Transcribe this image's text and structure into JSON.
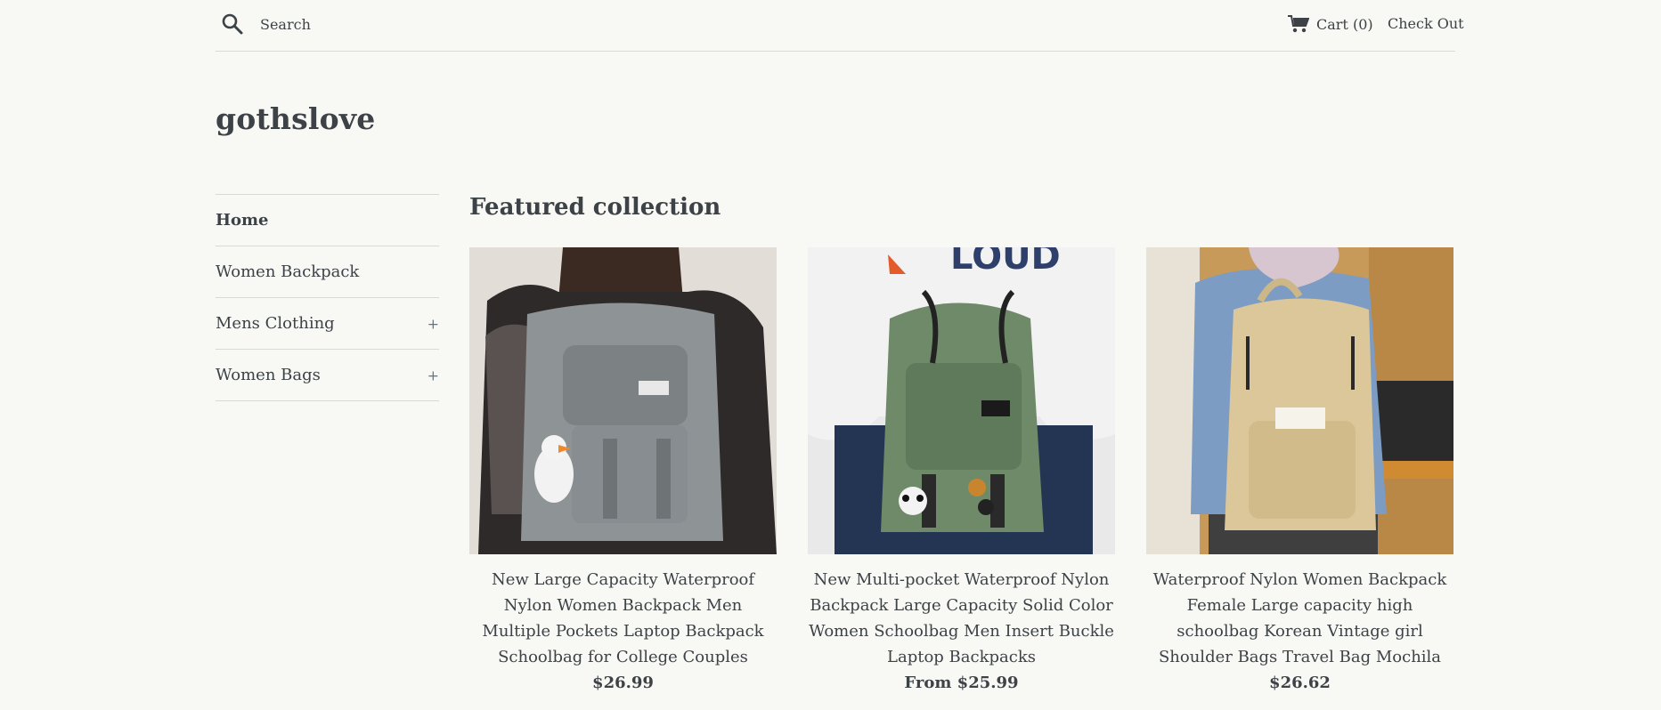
{
  "header": {
    "search_placeholder": "Search",
    "cart_label": "Cart (0)",
    "checkout_label": "Check Out"
  },
  "site": {
    "logo": "gothslove"
  },
  "sidebar": {
    "items": [
      {
        "label": "Home",
        "active": true,
        "expandable": false
      },
      {
        "label": "Women Backpack",
        "active": false,
        "expandable": false
      },
      {
        "label": "Mens Clothing",
        "active": false,
        "expandable": true,
        "toggle": "+"
      },
      {
        "label": "Women Bags",
        "active": false,
        "expandable": true,
        "toggle": "+"
      }
    ]
  },
  "main": {
    "section_title": "Featured collection",
    "products": [
      {
        "title": "New Large Capacity Waterproof Nylon Women Backpack Men Multiple Pockets Laptop Backpack Schoolbag for College Couples",
        "price": "$26.99",
        "bag_color": "#8e9496"
      },
      {
        "title": "New Multi-pocket Waterproof Nylon Backpack Large Capacity Solid Color Women Schoolbag Men Insert Buckle Laptop Backpacks",
        "price": "From $25.99",
        "bag_color": "#6e8a68"
      },
      {
        "title": "Waterproof Nylon Women Backpack Female Large capacity high schoolbag Korean Vintage girl Shoulder Bags Travel Bag Mochila",
        "price": "$26.62",
        "bag_color": "#dcc79a"
      }
    ]
  },
  "colors": {
    "background": "#f8f8f5",
    "text": "#3d4246",
    "divider": "#d8d8d4"
  }
}
